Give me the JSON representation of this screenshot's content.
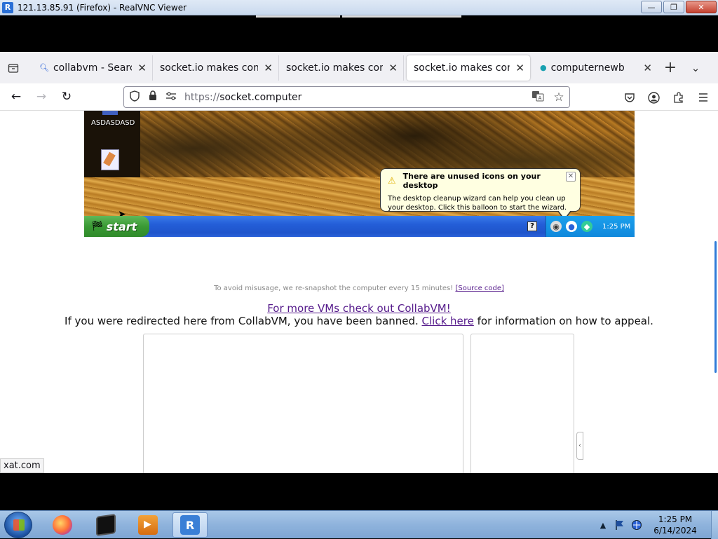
{
  "vnc_window": {
    "title": "121.13.85.91 (Firefox) - RealVNC Viewer",
    "app_icon": "R",
    "buttons": {
      "minimize": "—",
      "maximize": "❐",
      "close": "✕"
    }
  },
  "browser": {
    "tabs": [
      {
        "label": "collabvm - Search",
        "icon": "search-icon"
      },
      {
        "label": "socket.io makes comp",
        "icon": ""
      },
      {
        "label": "socket.io makes comp",
        "icon": ""
      },
      {
        "label": "socket.io makes comp",
        "icon": "",
        "active": true
      },
      {
        "label": "computernewb",
        "icon": "favicon"
      }
    ],
    "tab_close": "✕",
    "new_tab": "+",
    "tab_list": "⌄",
    "url_scheme": "https://",
    "url_host": "socket.computer",
    "status_link": "xat.com"
  },
  "vm": {
    "desktop_label": "ASDASDASD",
    "start_label": "start",
    "help_label": "?",
    "clock": "1:25 PM",
    "balloon": {
      "title": "There are unused icons on your desktop",
      "body": "The desktop cleanup wizard can help you clean up your desktop. Click this balloon to start the wizard.",
      "close": "✕"
    }
  },
  "page": {
    "notice_text": "To avoid misusage, we re-snapshot the computer every 15 minutes!",
    "source_link": "[Source code]",
    "collab_link": "For more VMs check out CollabVM!",
    "banned_prefix": "If you were redirected here from CollabVM, you have been banned.",
    "banned_link": "Click here",
    "banned_suffix": "for information on how to appeal.",
    "side_toggle": "‹"
  },
  "taskbar": {
    "apps": [
      {
        "name": "firefox"
      },
      {
        "name": "command-prompt"
      },
      {
        "name": "media-player"
      },
      {
        "name": "realvnc-viewer",
        "active": true
      }
    ],
    "clock_time": "1:25 PM",
    "clock_date": "6/14/2024"
  },
  "colors": {
    "link": "#551a8b",
    "xp_taskbar": "#245ed8",
    "win7_taskbar": "#8fb3dc"
  }
}
